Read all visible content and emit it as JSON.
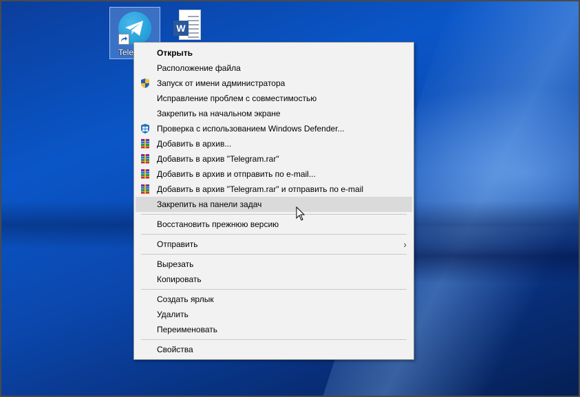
{
  "desktop": {
    "icons": [
      {
        "name": "telegram-shortcut",
        "label": "Tele"
      },
      {
        "name": "word-document",
        "label": ""
      }
    ]
  },
  "context_menu": {
    "items": [
      {
        "label": "Открыть",
        "bold": true,
        "icon": ""
      },
      {
        "label": "Расположение файла",
        "icon": ""
      },
      {
        "label": "Запуск от имени администратора",
        "icon": "uac-shield-icon"
      },
      {
        "label": "Исправление проблем с совместимостью",
        "icon": ""
      },
      {
        "label": "Закрепить на начальном экране",
        "icon": ""
      },
      {
        "label": "Проверка с использованием Windows Defender...",
        "icon": "windows-defender-icon"
      },
      {
        "label": "Добавить в архив...",
        "icon": "winrar-icon"
      },
      {
        "label": "Добавить в архив \"Telegram.rar\"",
        "icon": "winrar-icon"
      },
      {
        "label": "Добавить в архив и отправить по e-mail...",
        "icon": "winrar-icon"
      },
      {
        "label": "Добавить в архив \"Telegram.rar\" и отправить по e-mail",
        "icon": "winrar-icon"
      },
      {
        "label": "Закрепить на панели задач",
        "icon": "",
        "hovered": true
      },
      {
        "label": "Восстановить прежнюю версию",
        "icon": ""
      },
      {
        "label": "Отправить",
        "icon": "",
        "submenu": true
      },
      {
        "label": "Вырезать",
        "icon": ""
      },
      {
        "label": "Копировать",
        "icon": ""
      },
      {
        "label": "Создать ярлык",
        "icon": ""
      },
      {
        "label": "Удалить",
        "icon": ""
      },
      {
        "label": "Переименовать",
        "icon": ""
      },
      {
        "label": "Свойства",
        "icon": ""
      }
    ],
    "submenu_arrow": "›"
  },
  "colors": {
    "menu_bg": "#f2f2f2",
    "hover_bg": "#dadada",
    "telegram_blue": "#229ed9",
    "word_blue": "#2b579a"
  }
}
